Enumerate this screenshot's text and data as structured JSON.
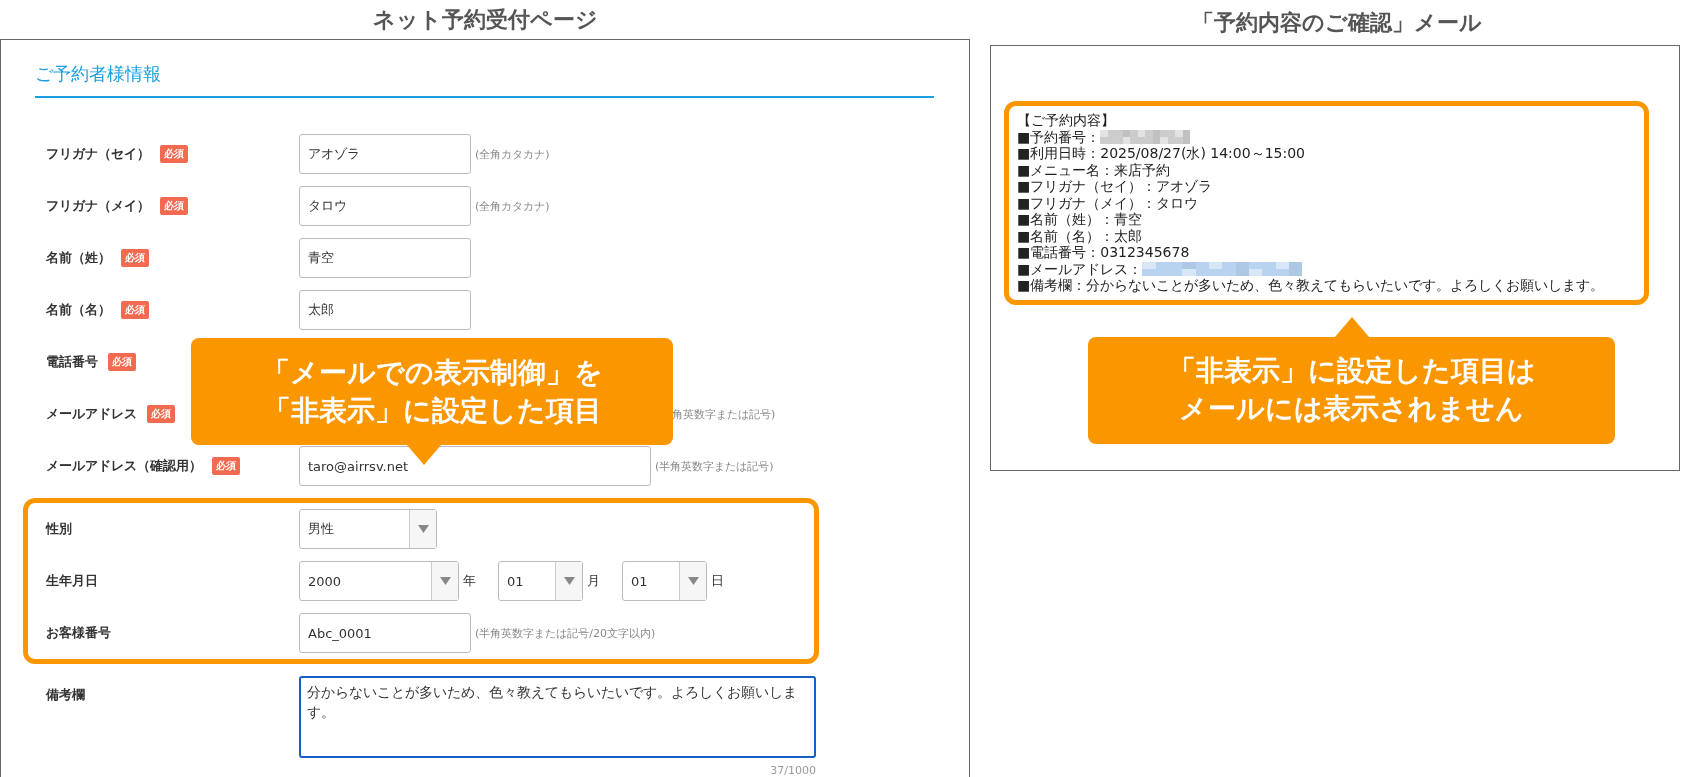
{
  "form_page": {
    "heading": "ネット予約受付ページ",
    "section_title": "ご予約者様情報",
    "fields": [
      {
        "label": "フリガナ（セイ）",
        "badge": "必須",
        "kind": "text",
        "value": "アオゾラ",
        "hint": "(全角カタカナ)",
        "hidden_in_mail": false
      },
      {
        "label": "フリガナ（メイ）",
        "badge": "必須",
        "kind": "text",
        "value": "タロウ",
        "hint": "(全角カタカナ)",
        "hidden_in_mail": false
      },
      {
        "label": "名前（姓）",
        "badge": "必須",
        "kind": "text",
        "value": "青空",
        "hidden_in_mail": false
      },
      {
        "label": "名前（名）",
        "badge": "必須",
        "kind": "text",
        "value": "太郎",
        "hidden_in_mail": false
      },
      {
        "label": "電話番号",
        "badge": "必須",
        "kind": "covered",
        "hidden_in_mail": false
      },
      {
        "label": "メールアドレス",
        "badge": "必須",
        "kind": "covered",
        "hint": "角英数字または記号)",
        "hidden_in_mail": false
      },
      {
        "label": "メールアドレス（確認用）",
        "badge": "必須",
        "kind": "email",
        "value": "taro@airrsv.net",
        "hint": "(半角英数字または記号)",
        "hidden_in_mail": false
      },
      {
        "label": "性別",
        "kind": "select",
        "value": "男性",
        "hidden_in_mail": true
      },
      {
        "label": "生年月日",
        "kind": "date",
        "parts": [
          {
            "value": "2000",
            "unit": "年"
          },
          {
            "value": "01",
            "unit": "月"
          },
          {
            "value": "01",
            "unit": "日"
          }
        ],
        "hidden_in_mail": true
      },
      {
        "label": "お客様番号",
        "kind": "text",
        "value": "Abc_0001",
        "hint": "(半角英数字または記号/20文字以内)",
        "hidden_in_mail": true
      },
      {
        "label": "備考欄",
        "kind": "textarea",
        "value": "分からないことが多いため、色々教えてもらいたいです。よろしくお願いします。",
        "counter": "37/1000",
        "hidden_in_mail": false
      }
    ],
    "callout": [
      "「メールでの表示制御」を",
      "「非表示」に設定した項目"
    ]
  },
  "mail_page": {
    "heading": "「予約内容のご確認」メール",
    "lines": [
      {
        "text": "【ご予約内容】",
        "redacted": false
      },
      {
        "text": "■予約番号：",
        "redacted": true,
        "color": "#cccccc"
      },
      {
        "text": "■利用日時：2025/08/27(水) 14:00～15:00",
        "redacted": false
      },
      {
        "text": "■メニュー名：来店予約",
        "redacted": false
      },
      {
        "text": "■フリガナ（セイ）：アオゾラ",
        "redacted": false
      },
      {
        "text": "■フリガナ（メイ）：タロウ",
        "redacted": false
      },
      {
        "text": "■名前（姓）：青空",
        "redacted": false
      },
      {
        "text": "■名前（名）：太郎",
        "redacted": false
      },
      {
        "text": "■電話番号：0312345678",
        "redacted": false
      },
      {
        "text": "■メールアドレス：",
        "redacted": true,
        "color": "#b7d3ef"
      },
      {
        "text": "■備考欄：分からないことが多いため、色々教えてもらいたいです。よろしくお願いします。",
        "redacted": false
      }
    ],
    "callout": [
      "「非表示」に設定した項目は",
      "メールには表示されません"
    ]
  }
}
